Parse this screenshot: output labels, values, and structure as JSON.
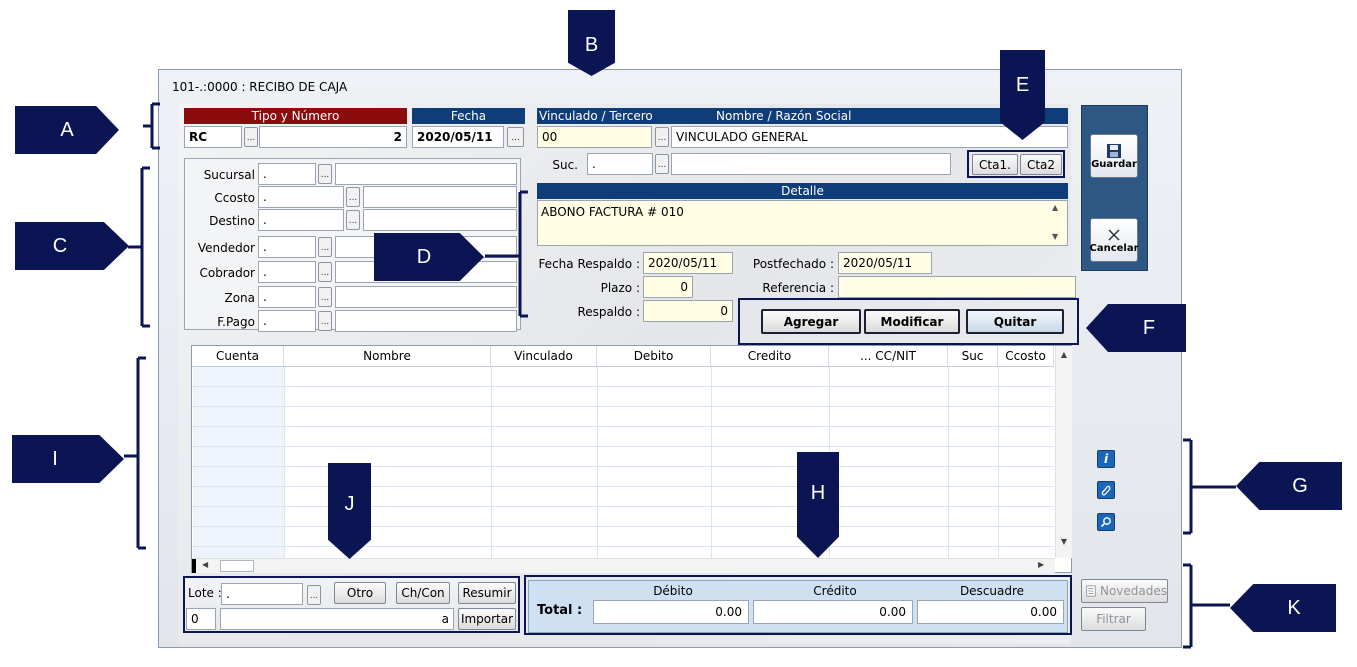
{
  "window": {
    "title": "101-.:0000 : RECIBO DE CAJA"
  },
  "callouts": [
    "A",
    "B",
    "C",
    "D",
    "E",
    "F",
    "G",
    "H",
    "I",
    "J",
    "K"
  ],
  "tipo": {
    "header": "Tipo y Número",
    "code": "RC",
    "number": "2",
    "ellipsis": "..."
  },
  "fecha": {
    "header": "Fecha",
    "value": "2020/05/11",
    "ellipsis": "..."
  },
  "vinculado": {
    "header_left": "Vinculado / Tercero",
    "header_right": "Nombre / Razón Social",
    "code": "00",
    "name": "VINCULADO GENERAL",
    "suc_label": "Suc.",
    "suc_value": ".",
    "cta1": "Cta1.",
    "cta2": "Cta2"
  },
  "left_fields": [
    {
      "label": "Sucursal",
      "value": "."
    },
    {
      "label": "Ccosto",
      "value": "."
    },
    {
      "label": "Destino",
      "value": "."
    },
    {
      "label": "Vendedor",
      "value": "."
    },
    {
      "label": "Cobrador",
      "value": "."
    },
    {
      "label": "Zona",
      "value": "."
    },
    {
      "label": "F.Pago",
      "value": "."
    }
  ],
  "detalle": {
    "header": "Detalle",
    "text": "ABONO FACTURA # 010"
  },
  "respaldo": {
    "fecha_label": "Fecha Respaldo :",
    "fecha_value": "2020/05/11",
    "postfechado_label": "Postfechado :",
    "postfechado_value": "2020/05/11",
    "plazo_label": "Plazo :",
    "plazo_value": "0",
    "referencia_label": "Referencia :",
    "referencia_value": "",
    "respaldo_label": "Respaldo :",
    "respaldo_value": "0"
  },
  "actions": {
    "agregar": "Agregar",
    "modificar": "Modificar",
    "quitar": "Quitar"
  },
  "side": {
    "guardar": "Guardar",
    "cancelar": "Cancelar"
  },
  "grid": {
    "columns": [
      "Cuenta",
      "Nombre",
      "Vinculado",
      "Debito",
      "Credito",
      "... CC/NIT",
      "Suc",
      "Ccosto"
    ]
  },
  "lote": {
    "label": "Lote :",
    "value": ".",
    "otro": "Otro",
    "chcon": "Ch/Con",
    "resumir": "Resumir",
    "count": "0",
    "a_label": "a",
    "importar": "Importar"
  },
  "totals": {
    "label": "Total :",
    "debito_header": "Débito",
    "credito_header": "Crédito",
    "descuadre_header": "Descuadre",
    "debito": "0.00",
    "credito": "0.00",
    "descuadre": "0.00"
  },
  "bottom_right": {
    "novedades": "Novedades",
    "filtrar": "Filtrar"
  }
}
